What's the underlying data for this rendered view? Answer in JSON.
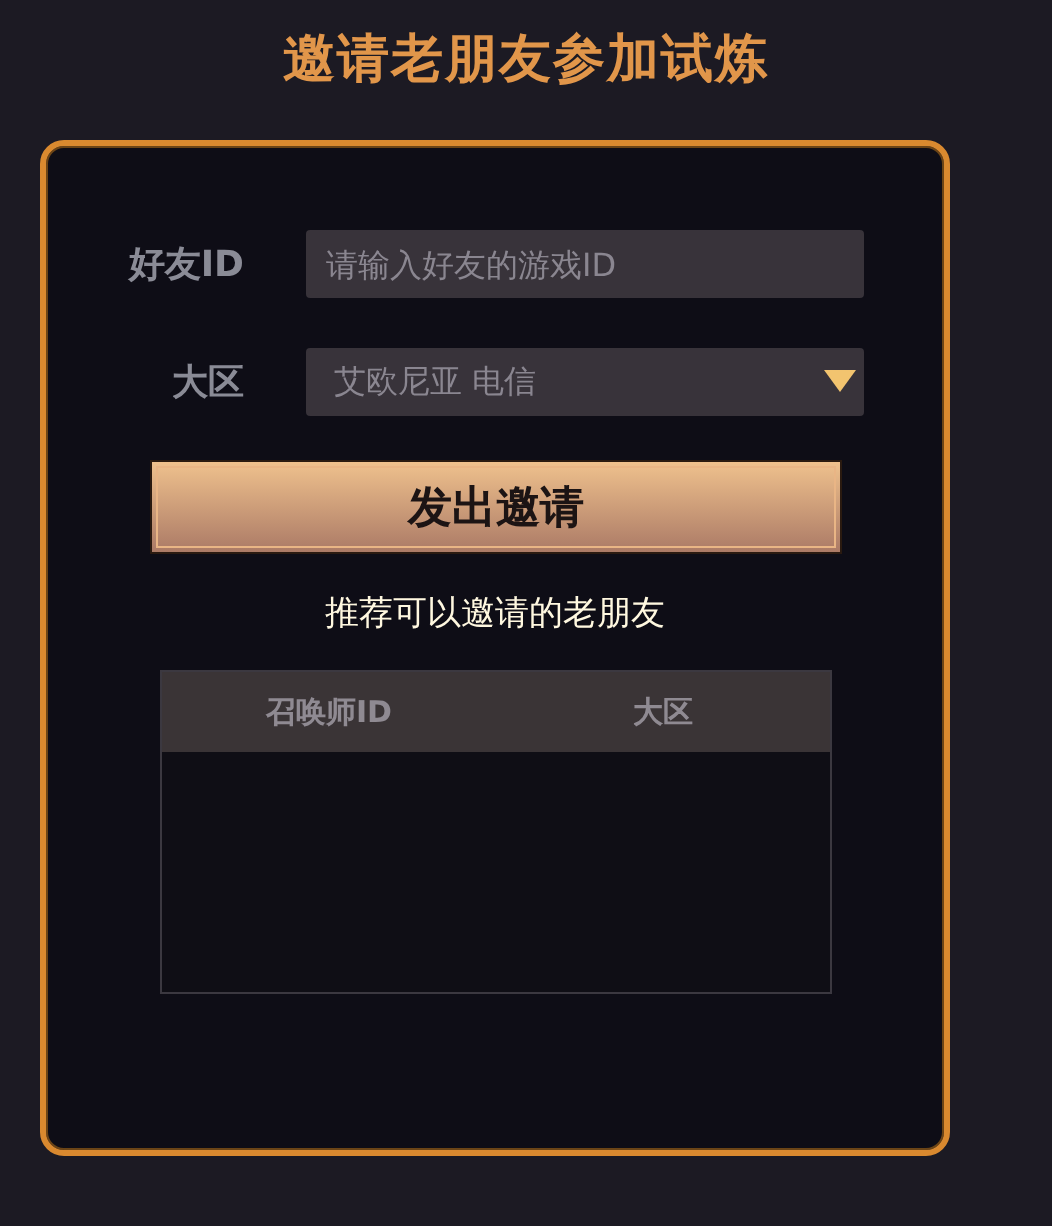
{
  "title": "邀请老朋友参加试炼",
  "fields": [
    {
      "kind": "text",
      "label": "好友ID",
      "placeholder": "请输入好友的游戏ID"
    },
    {
      "kind": "select",
      "label": "大区",
      "value": "艾欧尼亚 电信"
    }
  ],
  "button": "发出邀请",
  "subtitle": "推荐可以邀请的老朋友",
  "table": {
    "columns": [
      "召唤师ID",
      "大区"
    ]
  }
}
